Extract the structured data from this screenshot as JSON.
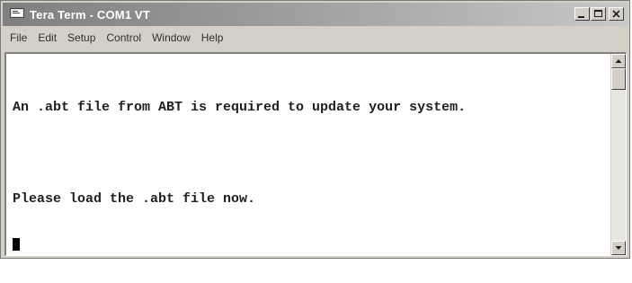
{
  "window": {
    "title": "Tera Term - COM1 VT",
    "app_icon": "terminal-icon",
    "buttons": [
      "minimize-icon",
      "maximize-icon",
      "close-icon"
    ]
  },
  "menu": {
    "items": [
      {
        "label": "File"
      },
      {
        "label": "Edit"
      },
      {
        "label": "Setup"
      },
      {
        "label": "Control"
      },
      {
        "label": "Window"
      },
      {
        "label": "Help"
      }
    ]
  },
  "terminal": {
    "lines": [
      "An .abt file from ABT is required to update your system.",
      "Please load the .abt file now."
    ]
  },
  "colors": {
    "titlebar_start": "#7f7f7f",
    "titlebar_end": "#c8c8c8",
    "title_text": "#ffffff",
    "chrome": "#d4d0c8",
    "terminal_bg": "#ffffff",
    "terminal_text": "#202020"
  }
}
